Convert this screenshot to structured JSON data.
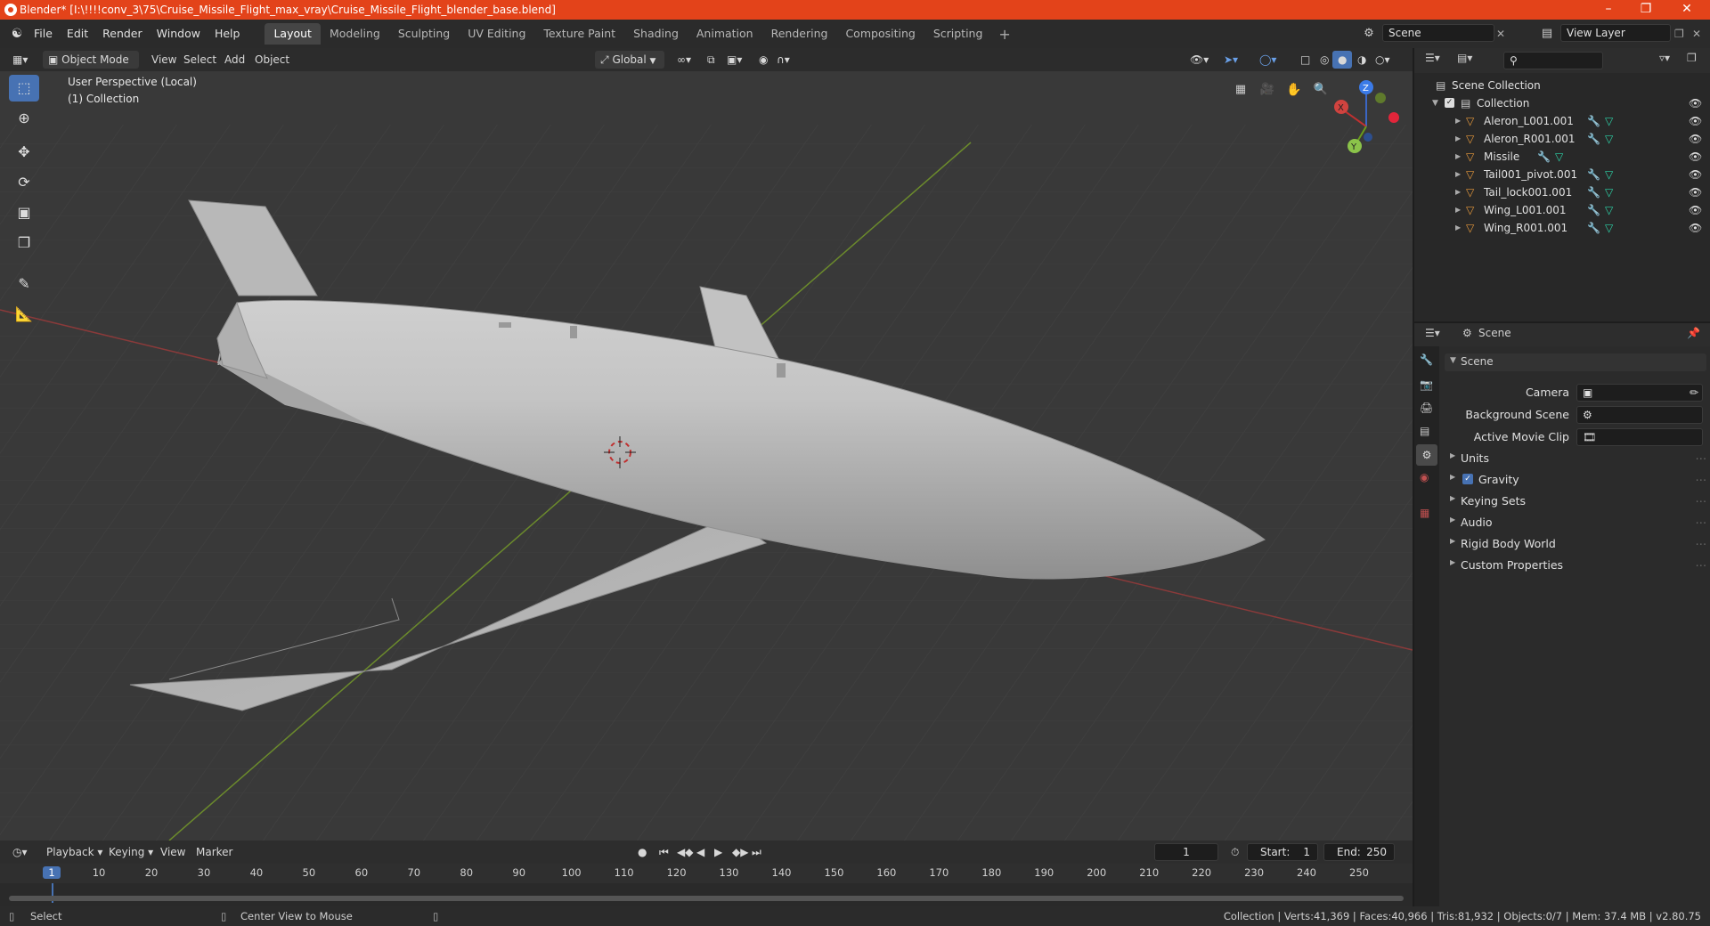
{
  "window": {
    "title": "Blender* [I:\\!!!!conv_3\\75\\Cruise_Missile_Flight_max_vray\\Cruise_Missile_Flight_blender_base.blend]",
    "accent": "#e3431a"
  },
  "menu": [
    "File",
    "Edit",
    "Render",
    "Window",
    "Help"
  ],
  "workspaces": [
    "Layout",
    "Modeling",
    "Sculpting",
    "UV Editing",
    "Texture Paint",
    "Shading",
    "Animation",
    "Rendering",
    "Compositing",
    "Scripting"
  ],
  "active_workspace": "Layout",
  "scene_field": "Scene",
  "view_layer_field": "View Layer",
  "viewport_header": {
    "mode": "Object Mode",
    "menus": [
      "View",
      "Select",
      "Add",
      "Object"
    ],
    "orientation": "Global"
  },
  "viewport": {
    "perspective_label": "User Perspective (Local)",
    "collection_label": "(1) Collection",
    "gizmo": {
      "z": "Z",
      "x": "X",
      "y": "Y"
    }
  },
  "outliner": {
    "root": "Scene Collection",
    "collection": "Collection",
    "objects": [
      "Aleron_L001.001",
      "Aleron_R001.001",
      "Missile",
      "Tail001_pivot.001",
      "Tail_lock001.001",
      "Wing_L001.001",
      "Wing_R001.001"
    ]
  },
  "properties": {
    "header": "Scene",
    "panel_title": "Scene",
    "fields": [
      {
        "label": "Camera"
      },
      {
        "label": "Background Scene"
      },
      {
        "label": "Active Movie Clip"
      }
    ],
    "sections": [
      "Units",
      "Gravity",
      "Keying Sets",
      "Audio",
      "Rigid Body World",
      "Custom Properties"
    ],
    "gravity_checked": true
  },
  "timeline": {
    "menus": [
      "Playback",
      "Keying",
      "View",
      "Marker"
    ],
    "current_frame": "1",
    "start_label": "Start:",
    "start": "1",
    "end_label": "End:",
    "end": "250",
    "ticks": [
      "1",
      "10",
      "20",
      "30",
      "40",
      "50",
      "60",
      "70",
      "80",
      "90",
      "100",
      "110",
      "120",
      "130",
      "140",
      "150",
      "160",
      "170",
      "180",
      "190",
      "200",
      "210",
      "220",
      "230",
      "240",
      "250"
    ]
  },
  "statusbar": {
    "left": "Select",
    "middle": "Center View to Mouse",
    "stats": "Collection | Verts:41,369 | Faces:40,966 | Tris:81,932 | Objects:0/7 | Mem: 37.4 MB | v2.80.75"
  }
}
